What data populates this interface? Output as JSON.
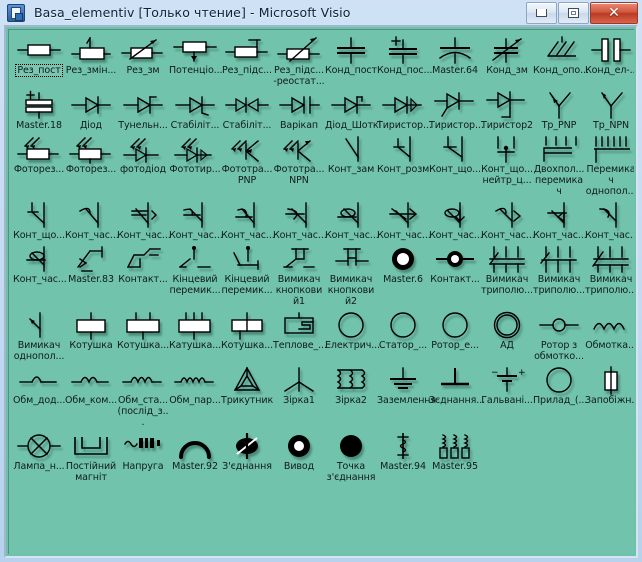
{
  "window": {
    "title": "Basa_elementiv  [Только чтение] - Microsoft Visio",
    "icon": "visio-document-icon",
    "buttons": {
      "minimize": "minimize-button",
      "maximize": "maximize-button",
      "close": "close-button",
      "close_glyph": "✕"
    },
    "colors": {
      "stencil_background": "#72c3ab",
      "titlebar_gradient_top": "#cfe2f5",
      "close_button": "#ba3a22",
      "shape_stroke": "#000000"
    }
  },
  "stencil": {
    "name": "Basa_elementiv",
    "columns": 12,
    "selected_index": 0,
    "rows": [
      {
        "index": 0,
        "items": [
          {
            "label": "Рез_пост",
            "icon": "resistor-fixed-icon",
            "selected": true
          },
          {
            "label": "Рез_змін...",
            "icon": "resistor-variable-icon",
            "selected": false
          },
          {
            "label": "Рез_зм",
            "icon": "resistor-adjustable-arrow-icon",
            "selected": false
          },
          {
            "label": "Потенціо...",
            "icon": "potentiometer-icon",
            "selected": false
          },
          {
            "label": "Рез_підс...",
            "icon": "resistor-tapped-icon",
            "selected": false
          },
          {
            "label": "Рез_підс...\n-реостат...",
            "icon": "rheostat-icon",
            "selected": false
          },
          {
            "label": "Конд_пост",
            "icon": "capacitor-fixed-icon",
            "selected": false
          },
          {
            "label": "Конд_пос...",
            "icon": "capacitor-polarized-icon",
            "selected": false
          },
          {
            "label": "Master.64",
            "icon": "capacitor-curved-icon",
            "selected": false
          },
          {
            "label": "Конд_зм",
            "icon": "capacitor-variable-icon",
            "selected": false
          },
          {
            "label": "Конд_опо...",
            "icon": "capacitor-trimmer-icon",
            "selected": false
          },
          {
            "label": "Конд_ел-...",
            "icon": "capacitor-electrolytic-icon",
            "selected": false
          }
        ]
      },
      {
        "index": 1,
        "items": [
          {
            "label": "Master.18",
            "icon": "capacitor-polar-block-icon",
            "selected": false
          },
          {
            "label": "Діод",
            "icon": "diode-icon",
            "selected": false
          },
          {
            "label": "Тунельн...",
            "icon": "tunnel-diode-icon",
            "selected": false
          },
          {
            "label": "Стабіліт...",
            "icon": "zener-diode-icon",
            "selected": false
          },
          {
            "label": "Стабіліт...",
            "icon": "bidirectional-zener-icon",
            "selected": false
          },
          {
            "label": "Варікап",
            "icon": "varicap-icon",
            "selected": false
          },
          {
            "label": "Діод_Шоткі",
            "icon": "schottky-diode-icon",
            "selected": false
          },
          {
            "label": "Тиристор...",
            "icon": "thyristor-1-icon",
            "selected": false
          },
          {
            "label": "Тиристор...",
            "icon": "thyristor-gate-icon",
            "selected": false
          },
          {
            "label": "Тиристор2",
            "icon": "thyristor-2-icon",
            "selected": false
          },
          {
            "label": "Тр_PNP",
            "icon": "transistor-pnp-icon",
            "selected": false
          },
          {
            "label": "Тр_NPN",
            "icon": "transistor-npn-icon",
            "selected": false
          }
        ]
      },
      {
        "index": 2,
        "items": [
          {
            "label": "Фоторез...",
            "icon": "photoresistor-icon",
            "selected": false
          },
          {
            "label": "Фоторез...",
            "icon": "photoresistor-2-icon",
            "selected": false
          },
          {
            "label": "фотодіод",
            "icon": "photodiode-icon",
            "selected": false
          },
          {
            "label": "Фототир...",
            "icon": "photothyristor-icon",
            "selected": false
          },
          {
            "label": "Фототра...\nPNP",
            "icon": "phototransistor-pnp-icon",
            "selected": false
          },
          {
            "label": "Фототра...\nNPN",
            "icon": "phototransistor-npn-icon",
            "selected": false
          },
          {
            "label": "Конт_зам",
            "icon": "contact-no-icon",
            "selected": false
          },
          {
            "label": "Конт_розм",
            "icon": "contact-nc-icon",
            "selected": false
          },
          {
            "label": "Конт_що...",
            "icon": "contact-changeover-icon",
            "selected": false
          },
          {
            "label": "Конт_що...\nнейтр_ц...",
            "icon": "contact-neutral-icon",
            "selected": false
          },
          {
            "label": "Двохпол...\nперемикач",
            "icon": "two-pole-switch-icon",
            "selected": false
          },
          {
            "label": "Перемикач\nоднопол...",
            "icon": "single-pole-multiway-switch-icon",
            "selected": false
          }
        ]
      },
      {
        "index": 3,
        "items": [
          {
            "label": "Конт_що...",
            "icon": "contact-changeover-2-icon",
            "selected": false
          },
          {
            "label": "Конт_час...",
            "icon": "timed-contact-1-icon",
            "selected": false
          },
          {
            "label": "Конт_час...",
            "icon": "timed-contact-2-icon",
            "selected": false
          },
          {
            "label": "Конт_час...",
            "icon": "timed-contact-3-icon",
            "selected": false
          },
          {
            "label": "Конт_час...",
            "icon": "timed-contact-4-icon",
            "selected": false
          },
          {
            "label": "Конт_час...",
            "icon": "timed-contact-5-icon",
            "selected": false
          },
          {
            "label": "Конт_час...",
            "icon": "timed-contact-6-icon",
            "selected": false
          },
          {
            "label": "Конт_час...",
            "icon": "timed-contact-7-icon",
            "selected": false
          },
          {
            "label": "Конт_час...",
            "icon": "timed-contact-8-icon",
            "selected": false
          },
          {
            "label": "Конт_час...",
            "icon": "timed-contact-9-icon",
            "selected": false
          },
          {
            "label": "Конт_час...",
            "icon": "timed-contact-10-icon",
            "selected": false
          },
          {
            "label": "Конт_час...",
            "icon": "timed-contact-11-icon",
            "selected": false
          }
        ]
      },
      {
        "index": 4,
        "items": [
          {
            "label": "Конт_час...",
            "icon": "timed-contact-12-icon",
            "selected": false
          },
          {
            "label": "Master.83",
            "icon": "contact-master83-icon",
            "selected": false
          },
          {
            "label": "Контакт...",
            "icon": "contact-group-icon",
            "selected": false
          },
          {
            "label": "Кінцевий\nперемик...",
            "icon": "limit-switch-1-icon",
            "selected": false
          },
          {
            "label": "Кінцевий\nперемик...",
            "icon": "limit-switch-2-icon",
            "selected": false
          },
          {
            "label": "Вимикач\nкнопковий1",
            "icon": "push-button-1-icon",
            "selected": false
          },
          {
            "label": "Вимикач\nкнопковий2",
            "icon": "push-button-2-icon",
            "selected": false
          },
          {
            "label": "Master.6",
            "icon": "terminal-ring-icon",
            "selected": false
          },
          {
            "label": "Контакт...",
            "icon": "contact-dot-icon",
            "selected": false
          },
          {
            "label": "Вимикач\nтриполю...",
            "icon": "three-pole-switch-1-icon",
            "selected": false
          },
          {
            "label": "Вимикач\nтриполю...",
            "icon": "three-pole-switch-2-icon",
            "selected": false
          },
          {
            "label": "Вимикач\nтриполю...",
            "icon": "three-pole-switch-3-icon",
            "selected": false
          }
        ]
      },
      {
        "index": 5,
        "items": [
          {
            "label": "Вимикач\nоднопол...",
            "icon": "single-pole-switch-icon",
            "selected": false
          },
          {
            "label": "Котушка",
            "icon": "coil-1-icon",
            "selected": false
          },
          {
            "label": "Котушка...",
            "icon": "coil-2-icon",
            "selected": false
          },
          {
            "label": "Катушка...",
            "icon": "coil-3-icon",
            "selected": false
          },
          {
            "label": "Котушка...",
            "icon": "coil-split-icon",
            "selected": false
          },
          {
            "label": "Теплове_...",
            "icon": "thermal-relay-icon",
            "selected": false
          },
          {
            "label": "Електрич...",
            "icon": "electric-machine-icon",
            "selected": false
          },
          {
            "label": "Статор_...",
            "icon": "stator-icon",
            "selected": false
          },
          {
            "label": "Ротор_е...",
            "icon": "rotor-icon",
            "selected": false
          },
          {
            "label": "АД",
            "icon": "induction-motor-icon",
            "selected": false
          },
          {
            "label": "Ротор з\nобмотко...",
            "icon": "wound-rotor-icon",
            "selected": false
          },
          {
            "label": "Обмотка...",
            "icon": "winding-icon",
            "selected": false
          }
        ]
      },
      {
        "index": 6,
        "items": [
          {
            "label": "Обм_дод...",
            "icon": "winding-add-icon",
            "selected": false
          },
          {
            "label": "Обм_ком...",
            "icon": "winding-compound-icon",
            "selected": false
          },
          {
            "label": "Обм_ста...\n(послід_з...",
            "icon": "winding-series-icon",
            "selected": false
          },
          {
            "label": "Обм_пар...",
            "icon": "winding-parallel-icon",
            "selected": false
          },
          {
            "label": "Трикутник",
            "icon": "delta-connection-icon",
            "selected": false
          },
          {
            "label": "Зірка1",
            "icon": "star-connection-1-icon",
            "selected": false
          },
          {
            "label": "Зірка2",
            "icon": "star-connection-2-icon",
            "selected": false
          },
          {
            "label": "Заземлення",
            "icon": "ground-icon",
            "selected": false
          },
          {
            "label": "Зєднання...",
            "icon": "chassis-connection-icon",
            "selected": false
          },
          {
            "label": "Гальвані...",
            "icon": "battery-cell-icon",
            "selected": false
          },
          {
            "label": "Прилад_(...",
            "icon": "meter-circle-icon",
            "selected": false
          },
          {
            "label": "Запобіжн...",
            "icon": "fuse-icon",
            "selected": false
          }
        ]
      },
      {
        "index": 7,
        "items": [
          {
            "label": "Лампа_н...",
            "icon": "lamp-icon",
            "selected": false
          },
          {
            "label": "Постійний\nмагніт",
            "icon": "permanent-magnet-icon",
            "selected": false
          },
          {
            "label": "Напруга",
            "icon": "voltage-source-icon",
            "selected": false
          },
          {
            "label": "Master.92",
            "icon": "arc-jumper-icon",
            "selected": false
          },
          {
            "label": "З'єднання",
            "icon": "connection-crossing-icon",
            "selected": false
          },
          {
            "label": "Вивод",
            "icon": "terminal-output-icon",
            "selected": false
          },
          {
            "label": "Точка\nз'єднання",
            "icon": "junction-dot-icon",
            "selected": false
          },
          {
            "label": "Master.94",
            "icon": "master94-icon",
            "selected": false
          },
          {
            "label": "Master.95",
            "icon": "master95-icon",
            "selected": false
          }
        ]
      }
    ]
  }
}
